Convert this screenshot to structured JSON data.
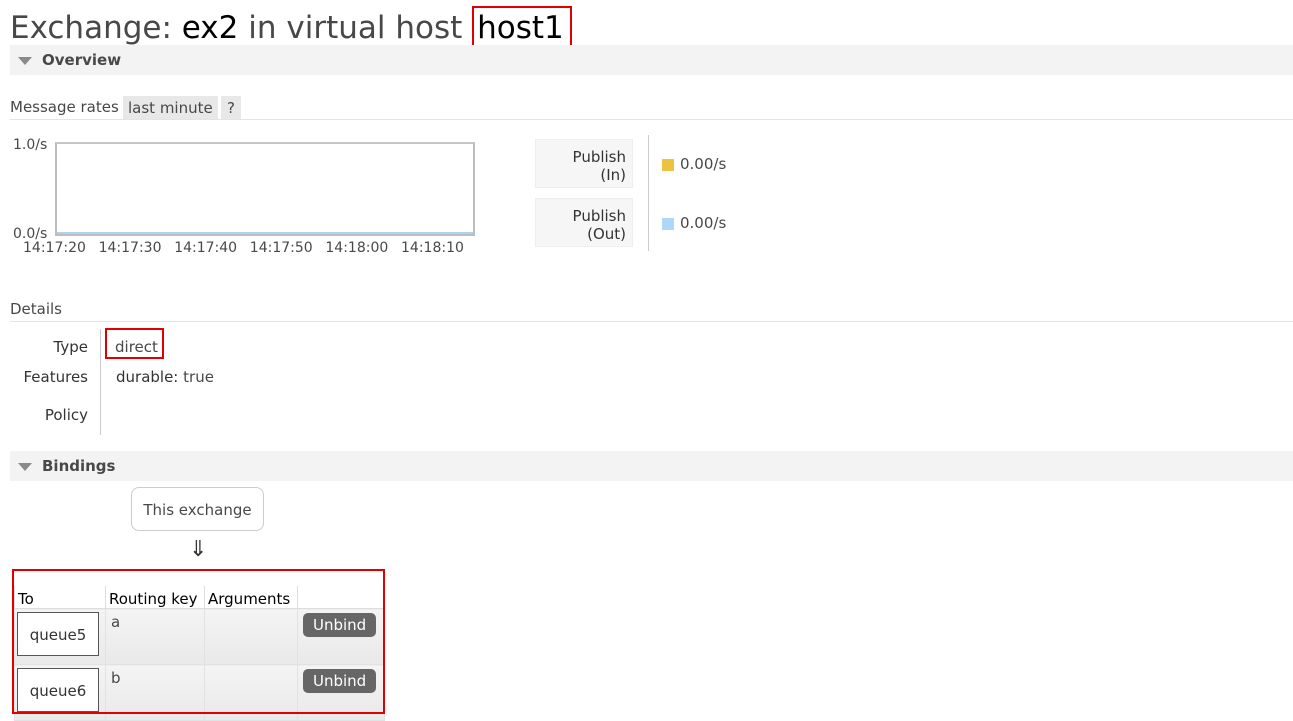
{
  "header": {
    "prefix": "Exchange: ",
    "name": "ex2",
    "middle": " in virtual host ",
    "vhost": "host1"
  },
  "overview": {
    "section_label": "Overview",
    "message_rates_label": "Message rates",
    "range_label": "last minute",
    "help_label": "?",
    "chart_data": {
      "type": "line",
      "x": [
        "14:17:20",
        "14:17:30",
        "14:17:40",
        "14:17:50",
        "14:18:00",
        "14:18:10"
      ],
      "series": [
        {
          "name": "Publish (In)",
          "values": [
            0,
            0,
            0,
            0,
            0,
            0
          ],
          "color": "#edc240"
        },
        {
          "name": "Publish (Out)",
          "values": [
            0,
            0,
            0,
            0,
            0,
            0
          ],
          "color": "#afd8f8"
        }
      ],
      "ylim": [
        0,
        1.0
      ],
      "ytick_labels": [
        "1.0/s",
        "0.0/s"
      ]
    },
    "legend": [
      {
        "label_line1": "Publish",
        "label_line2": "(In)",
        "value": "0.00/s",
        "color": "#edc240"
      },
      {
        "label_line1": "Publish",
        "label_line2": "(Out)",
        "value": "0.00/s",
        "color": "#afd8f8"
      }
    ]
  },
  "details": {
    "section_label": "Details",
    "type_label": "Type",
    "type_value": "direct",
    "features_label": "Features",
    "feature_key": "durable:",
    "feature_value": "true",
    "policy_label": "Policy"
  },
  "bindings": {
    "section_label": "Bindings",
    "this_exchange": "This exchange",
    "arrow": "⇓",
    "columns": [
      "To",
      "Routing key",
      "Arguments",
      ""
    ],
    "rows": [
      {
        "to": "queue5",
        "routing_key": "a",
        "arguments": "",
        "action": "Unbind"
      },
      {
        "to": "queue6",
        "routing_key": "b",
        "arguments": "",
        "action": "Unbind"
      }
    ]
  }
}
